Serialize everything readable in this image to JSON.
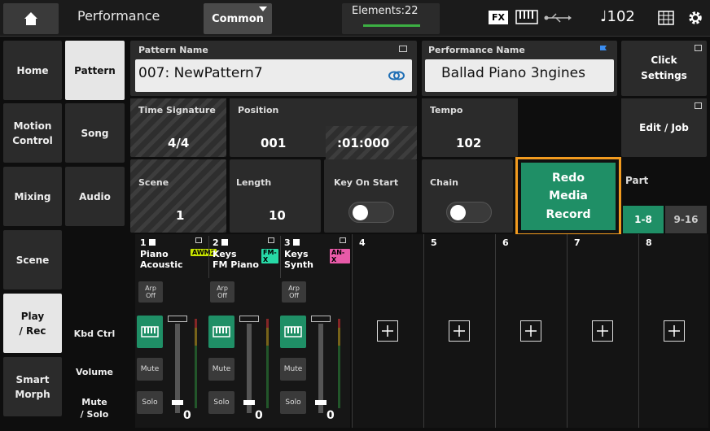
{
  "topbar": {
    "title": "Performance",
    "common_label": "Common",
    "elements_label": "Elements:22",
    "fx_label": "FX",
    "tempo_display": "♩102",
    "icons": [
      "home-icon",
      "keyboard-icon",
      "usb-icon",
      "grid-icon",
      "gear-icon"
    ]
  },
  "sidebar": {
    "items": [
      {
        "label": "Home"
      },
      {
        "label": "Motion\nControl"
      },
      {
        "label": "Mixing"
      },
      {
        "label": "Scene"
      },
      {
        "label": "Play\n/ Rec",
        "active": true
      },
      {
        "label": "Smart\nMorph"
      }
    ]
  },
  "subnav": {
    "items": [
      {
        "label": "Pattern",
        "active": true
      },
      {
        "label": "Song"
      },
      {
        "label": "Audio"
      }
    ]
  },
  "pattern": {
    "label": "Pattern Name",
    "value": "007: NewPattern7"
  },
  "performance": {
    "label": "Performance Name",
    "value": "Ballad Piano 3ngines"
  },
  "click_settings": {
    "label": "Click\nSettings"
  },
  "edit_job": {
    "label": "Edit / Job"
  },
  "time_signature": {
    "label": "Time Signature",
    "value": "4/4"
  },
  "position": {
    "label": "Position",
    "measure": "001",
    "tick": ":01:000"
  },
  "tempo": {
    "label": "Tempo",
    "value": "102"
  },
  "scene": {
    "label": "Scene",
    "value": "1"
  },
  "length": {
    "label": "Length",
    "value": "10"
  },
  "key_on_start": {
    "label": "Key On Start",
    "on": false
  },
  "chain": {
    "label": "Chain",
    "on": false
  },
  "redo": {
    "label": "Redo\nMedia\nRecord"
  },
  "part_select": {
    "label": "Part",
    "options": [
      "1-8",
      "9-16"
    ],
    "selected": "1-8"
  },
  "row_labels": {
    "kbd_ctrl": "Kbd Ctrl",
    "volume": "Volume",
    "mute_solo": "Mute\n/ Solo"
  },
  "parts": [
    {
      "num": "1",
      "name": "Piano\nAcoustic",
      "tag": "AWM2",
      "tag_color": "#c8e600",
      "arp": "Arp\nOff",
      "mute": "Mute",
      "solo": "Solo",
      "volume": "0"
    },
    {
      "num": "2",
      "name": "Keys\nFM Piano",
      "tag": "FM-X",
      "tag_color": "#27d9a6",
      "arp": "Arp\nOff",
      "mute": "Mute",
      "solo": "Solo",
      "volume": "0"
    },
    {
      "num": "3",
      "name": "Keys\nSynth",
      "tag": "AN-X",
      "tag_color": "#e85aa8",
      "arp": "Arp\nOff",
      "mute": "Mute",
      "solo": "Solo",
      "volume": "0"
    },
    {
      "num": "4"
    },
    {
      "num": "5"
    },
    {
      "num": "6"
    },
    {
      "num": "7"
    },
    {
      "num": "8"
    }
  ]
}
